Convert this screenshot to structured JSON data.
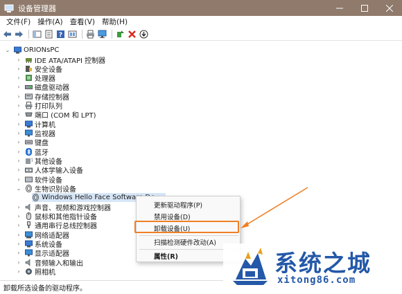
{
  "window": {
    "title": "设备管理器"
  },
  "menubar": {
    "items": [
      "文件(F)",
      "操作(A)",
      "查看(V)",
      "帮助(H)"
    ]
  },
  "tree": {
    "root": "ORIONsPC",
    "categories": [
      "IDE ATA/ATAPI 控制器",
      "安全设备",
      "处理器",
      "磁盘驱动器",
      "存储控制器",
      "打印队列",
      "端口 (COM 和 LPT)",
      "计算机",
      "监视器",
      "键盘",
      "蓝牙",
      "其他设备",
      "人体学输入设备",
      "软件设备",
      "生物识别设备",
      "声音、视频和游戏控制器",
      "鼠标和其他指针设备",
      "通用串行总线控制器",
      "网络适配器",
      "系统设备",
      "显示适配器",
      "音频输入和输出",
      "照相机"
    ],
    "selected_device": "Windows Hello Face Software De..."
  },
  "context_menu": {
    "items": [
      "更新驱动程序(P)",
      "禁用设备(D)",
      "卸载设备(U)",
      "扫描检测硬件改动(A)",
      "属性(R)"
    ],
    "highlighted": "卸载设备(U)"
  },
  "statusbar": {
    "text": "卸载所选设备的驱动程序。"
  },
  "watermark": {
    "title": "系统之城",
    "url": "xitong86.com"
  },
  "colors": {
    "titlebar": "#8f7a6c",
    "selection": "#d7e6f7",
    "highlight_outline": "#f07f24",
    "watermark_blue": "#2458a8"
  }
}
